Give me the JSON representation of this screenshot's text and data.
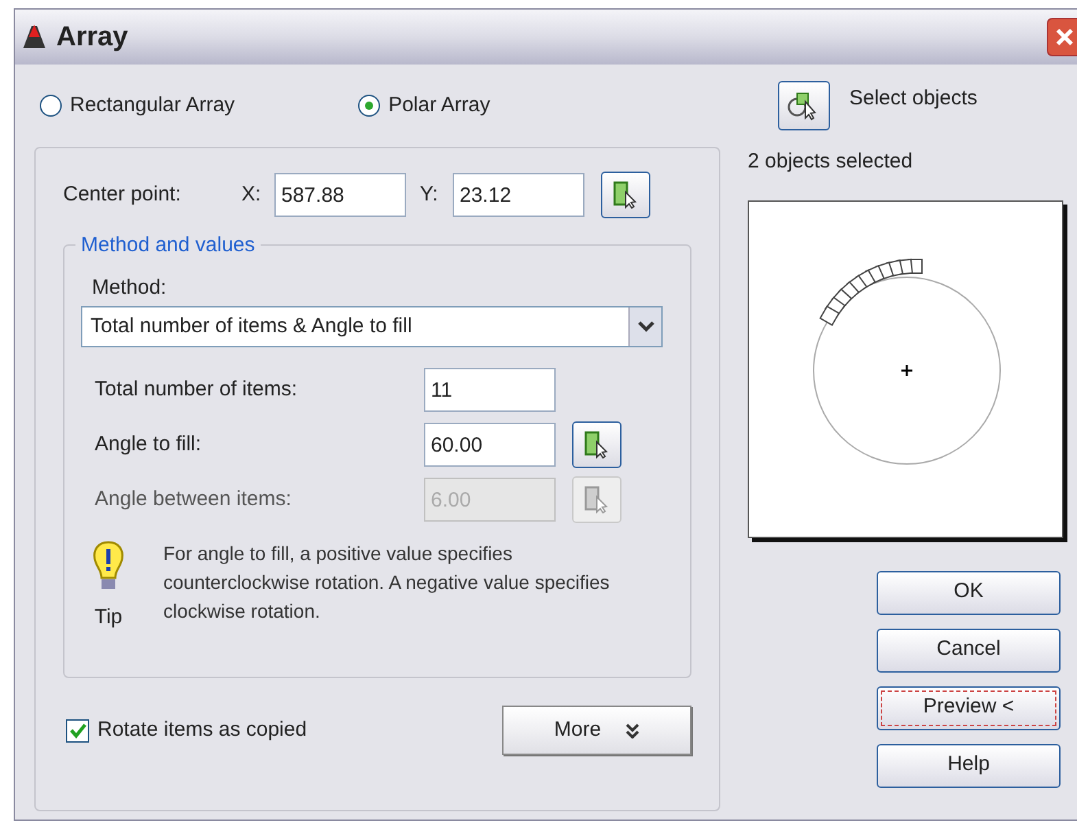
{
  "window": {
    "title": "Array"
  },
  "array_type": [
    {
      "label": "Rectangular Array",
      "selected": false
    },
    {
      "label": "Polar Array",
      "selected": true
    }
  ],
  "center_point": {
    "label": "Center point:",
    "x_label": "X:",
    "x_value": "587.88",
    "y_label": "Y:",
    "y_value": "23.12"
  },
  "select_objects": {
    "label": "Select objects",
    "status": "2 objects selected"
  },
  "method_group": {
    "title": "Method and values",
    "method_label": "Method:",
    "method_value": "Total number of items & Angle to fill",
    "fields": [
      {
        "label": "Total number of items:",
        "value": "11",
        "disabled": false,
        "pick_button": false
      },
      {
        "label": "Angle to fill:",
        "value": "60.00",
        "disabled": false,
        "pick_button": true
      },
      {
        "label": "Angle between items:",
        "value": "6.00",
        "disabled": true,
        "pick_button": true
      }
    ]
  },
  "tip": {
    "label": "Tip",
    "text": "For angle to fill, a positive value specifies counterclockwise rotation.  A negative value specifies clockwise rotation."
  },
  "rotate_items": {
    "label": "Rotate items as copied",
    "checked": true
  },
  "more_button": {
    "label": "More"
  },
  "buttons": [
    {
      "label": "OK",
      "focused": false
    },
    {
      "label": "Cancel",
      "focused": false
    },
    {
      "label": "Preview <",
      "focused": true
    },
    {
      "label": "Help",
      "focused": false
    }
  ]
}
